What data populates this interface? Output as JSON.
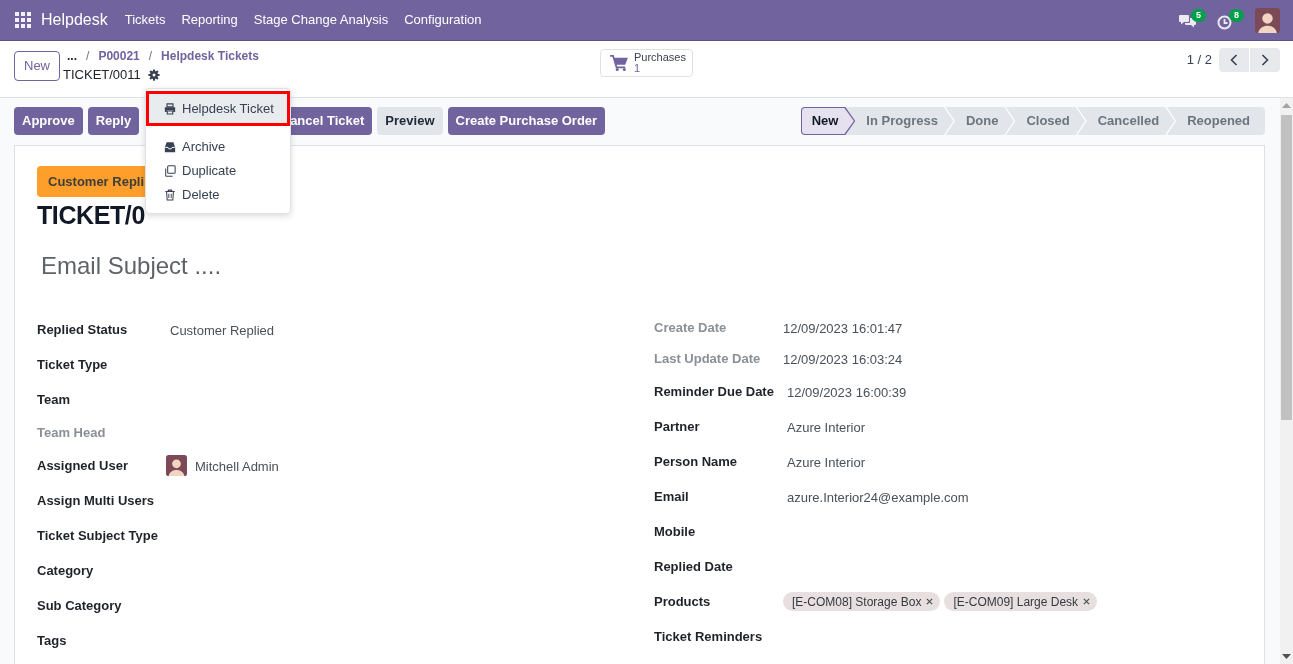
{
  "navbar": {
    "app_name": "Helpdesk",
    "menu": [
      {
        "label": "Tickets"
      },
      {
        "label": "Reporting"
      },
      {
        "label": "Stage Change Analysis"
      },
      {
        "label": "Configuration"
      }
    ],
    "systray": [
      {
        "kind": "messages",
        "badge": "5"
      },
      {
        "kind": "activities",
        "badge": "8"
      },
      {
        "kind": "user"
      }
    ]
  },
  "control_panel": {
    "new_button": "New",
    "breadcrumbs": [
      {
        "label": "...",
        "kind": "more"
      },
      {
        "label": "/",
        "kind": "separator"
      },
      {
        "label": "P00021",
        "kind": "link"
      },
      {
        "label": "/",
        "kind": "separator"
      },
      {
        "label": "Helpdesk Tickets",
        "kind": "link"
      }
    ],
    "record_name": "TICKET/0011",
    "smart_buttons": [
      {
        "label": "Purchases",
        "count": "1"
      }
    ],
    "pager": "1 / 2"
  },
  "action_buttons": [
    {
      "label": "Approve",
      "kind": "primary"
    },
    {
      "label": "Reply",
      "kind": "primary"
    },
    {
      "label": "ancel Ticket",
      "kind": "clipped"
    },
    {
      "label": "Preview",
      "kind": "secondary"
    },
    {
      "label": "Create Purchase Order",
      "kind": "primary"
    }
  ],
  "statusbar": [
    {
      "label": "New",
      "selected": true
    },
    {
      "label": "In Progress",
      "selected": false
    },
    {
      "label": "Done",
      "selected": false
    },
    {
      "label": "Closed",
      "selected": false
    },
    {
      "label": "Cancelled",
      "selected": false
    },
    {
      "label": "Reopened",
      "selected": false
    }
  ],
  "gear_menu": {
    "sections": [
      {
        "items": [
          {
            "label": "Helpdesk Ticket",
            "kind": "print",
            "selected": true,
            "framed": true
          }
        ]
      },
      {
        "items": [
          {
            "label": "Archive",
            "kind": "archive",
            "selected": false,
            "framed": false
          },
          {
            "label": "Duplicate",
            "kind": "duplicate",
            "selected": false,
            "framed": false
          },
          {
            "label": "Delete",
            "kind": "delete",
            "selected": false,
            "framed": false
          }
        ]
      }
    ]
  },
  "sheet": {
    "badge": "Customer Repli",
    "title": "TICKET/0",
    "subject_placeholder": "Email Subject ....",
    "left_fields": [
      {
        "label": "Replied Status",
        "kind": "text",
        "value": "Customer Replied",
        "readonly": false
      },
      {
        "label": "Ticket Type",
        "kind": "text",
        "readonly": false
      },
      {
        "label": "Team",
        "kind": "text",
        "readonly": false
      },
      {
        "label": "Team Head",
        "kind": "text",
        "readonly": true
      },
      {
        "label": "Assigned User",
        "kind": "user",
        "value": "Mitchell Admin",
        "readonly": false
      },
      {
        "label": "Assign Multi Users",
        "kind": "text",
        "readonly": false
      },
      {
        "label": "Ticket Subject Type",
        "kind": "text",
        "readonly": false
      },
      {
        "label": "Category",
        "kind": "text",
        "readonly": false
      },
      {
        "label": "Sub Category",
        "kind": "text",
        "readonly": false
      },
      {
        "label": "Tags",
        "kind": "text",
        "readonly": false
      }
    ],
    "right_fields": [
      {
        "label": "Create Date",
        "kind": "text",
        "value": "12/09/2023 16:01:47",
        "readonly": true
      },
      {
        "label": "Last Update Date",
        "kind": "text",
        "value": "12/09/2023 16:03:24",
        "readonly": true
      },
      {
        "label": "Reminder Due Date",
        "kind": "text",
        "value": "12/09/2023 16:00:39",
        "readonly": false
      },
      {
        "label": "Partner",
        "kind": "text",
        "value": "Azure Interior",
        "readonly": false
      },
      {
        "label": "Person Name",
        "kind": "text",
        "value": "Azure Interior",
        "readonly": false
      },
      {
        "label": "Email",
        "kind": "text",
        "value": "azure.Interior24@example.com",
        "readonly": false
      },
      {
        "label": "Mobile",
        "kind": "text",
        "readonly": false
      },
      {
        "label": "Replied Date",
        "kind": "text",
        "readonly": false
      },
      {
        "label": "Products",
        "kind": "tags",
        "tags": [
          "[E-COM08] Storage Box",
          "[E-COM09] Large Desk"
        ],
        "readonly": false
      },
      {
        "label": "Ticket Reminders",
        "kind": "text",
        "readonly": false
      }
    ]
  }
}
